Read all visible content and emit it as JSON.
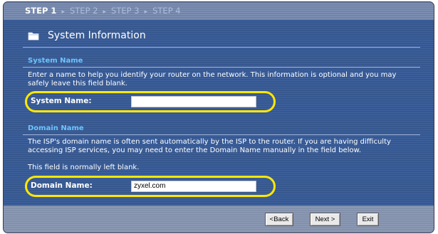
{
  "steps": {
    "items": [
      "STEP 1",
      "STEP 2",
      "STEP 3",
      "STEP 4"
    ],
    "separator": "▸"
  },
  "page": {
    "title": "System Information",
    "title_icon": "folder-icon"
  },
  "system_name": {
    "heading": "System Name",
    "description": "Enter a name to help you identify your router on the network. This information is optional and you may safely leave this field blank.",
    "label": "System Name:",
    "value": ""
  },
  "domain_name": {
    "heading": "Domain Name",
    "description": "The ISP's domain name is often sent automatically by the ISP to the router. If you are having difficulty accessing ISP services, you may need to enter the Domain Name manually in the field below.",
    "note": "This field is normally left blank.",
    "label": "Domain Name:",
    "value": "zyxel.com"
  },
  "buttons": {
    "back": "<Back",
    "next": "Next >",
    "exit": "Exit"
  },
  "colors": {
    "background": "#3f63a0",
    "section_heading": "#6ec3ff",
    "highlight_oval": "#ffe800"
  }
}
